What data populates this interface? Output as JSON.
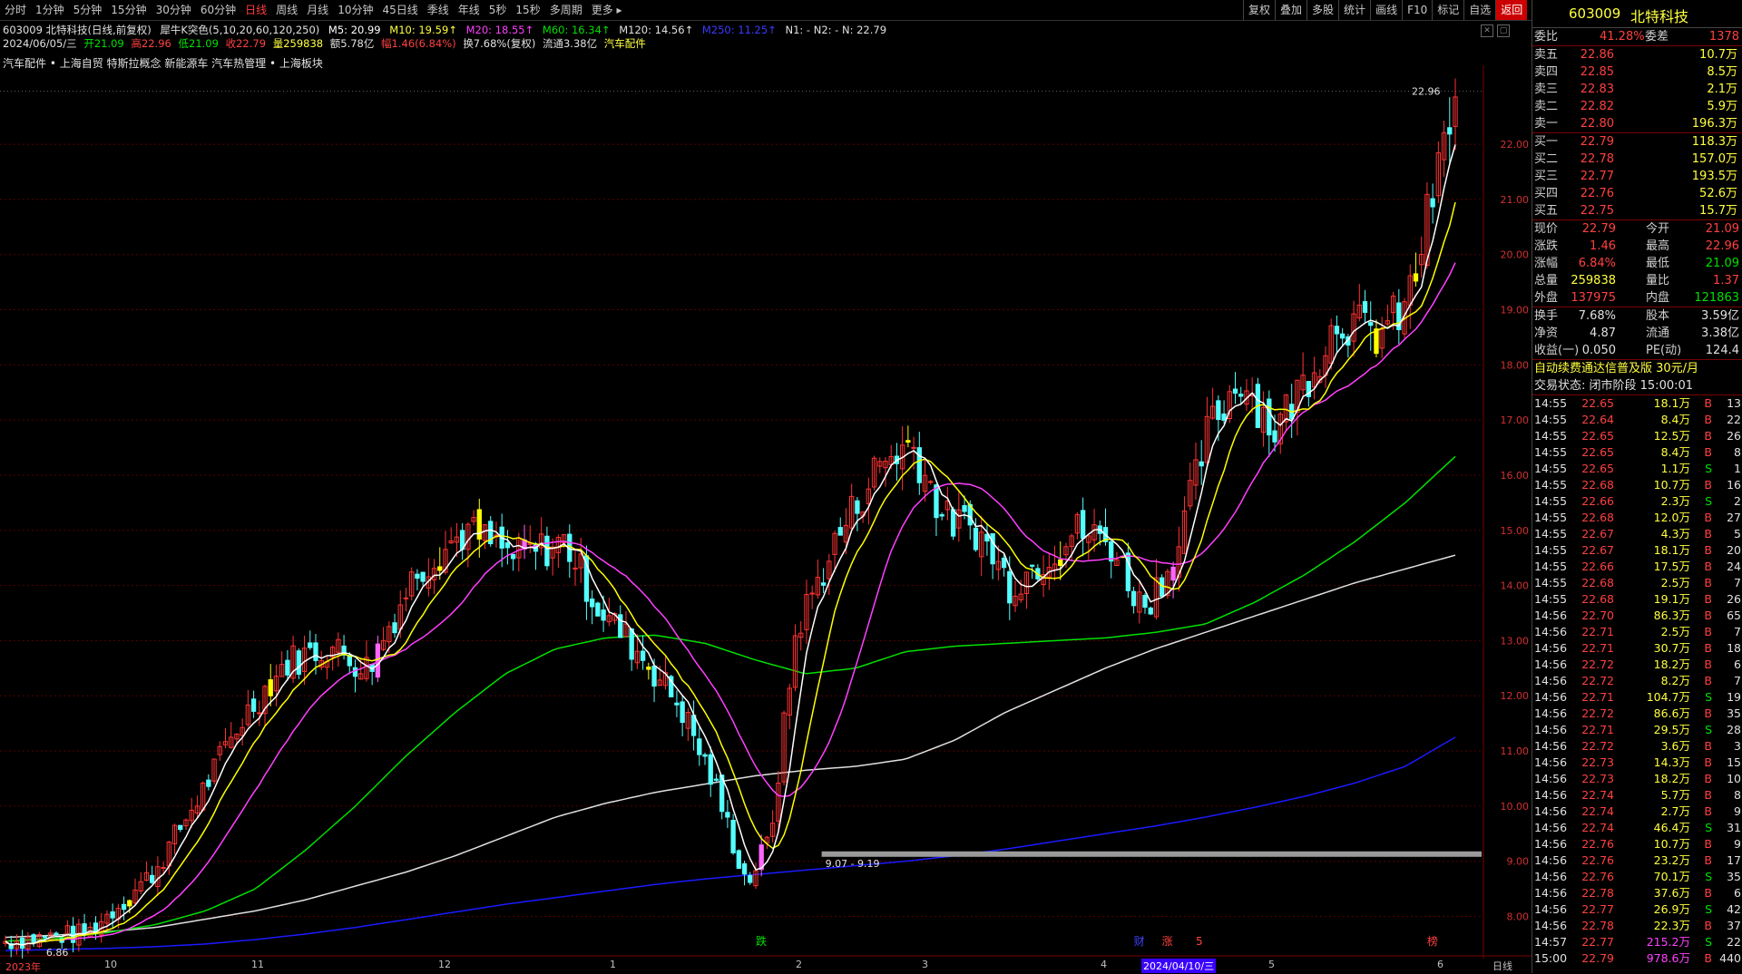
{
  "toolbar": {
    "periods": [
      "分时",
      "1分钟",
      "5分钟",
      "15分钟",
      "30分钟",
      "60分钟",
      "日线",
      "周线",
      "月线",
      "10分钟",
      "45日线",
      "季线",
      "年线",
      "5秒",
      "15秒",
      "多周期",
      "更多"
    ],
    "active_period": "日线",
    "right_buttons": [
      "复权",
      "叠加",
      "多股",
      "统计",
      "画线",
      "F10",
      "标记",
      "自选",
      "返回"
    ]
  },
  "info": {
    "stock": "603009 北特科技(日线,前复权)",
    "indicator": "犀牛K突色(5,10,20,60,120,250)",
    "m5": "M5: 20.99",
    "m10": "M10: 19.59↑",
    "m20": "M20: 18.55↑",
    "m60": "M60: 16.34↑",
    "m120": "M120: 14.56↑",
    "m250": "M250: 11.25↑",
    "n": "N1: -  N2: -  N: 22.79",
    "date": "2024/06/05/三",
    "open": "开21.09",
    "high": "高22.96",
    "low": "低21.09",
    "close": "收22.79",
    "vol": "量259838",
    "amt": "额5.78亿",
    "chg": "幅1.46(6.84%)",
    "turn": "换7.68%(复权)",
    "float": "流通3.38亿",
    "sector": "汽车配件",
    "concepts": "汽车配件 • 上海自贸 特斯拉概念 新能源车 汽车热管理 • 上海板块"
  },
  "chart_data": {
    "type": "candlestick",
    "y_ticks": [
      "22.00",
      "21.00",
      "20.00",
      "19.00",
      "18.00",
      "17.00",
      "16.00",
      "15.00",
      "14.00",
      "13.00",
      "12.00",
      "11.00",
      "10.00",
      "9.00",
      "8.00"
    ],
    "ylim": [
      7.4,
      23.3
    ],
    "max_label": "22.96",
    "min_label": "6.86",
    "gap_label": "9.07 - 9.19",
    "x_labels": [
      "2023年",
      "10",
      "11",
      "12",
      "1",
      "2",
      "3",
      "4",
      "2024/04/10/三",
      "5",
      "6",
      "日线"
    ],
    "markers": [
      "跌",
      "财",
      "涨",
      "5",
      "榜"
    ],
    "ma_colors": {
      "m5": "#ffffff",
      "m10": "#ffff00",
      "m20": "#ff40ff",
      "m60": "#00e000",
      "m120": "#e0e0e0",
      "m250": "#1a1aff"
    },
    "ma_levels": {
      "m120": [
        7.62,
        7.66,
        7.72,
        7.8,
        7.95,
        8.1,
        8.3,
        8.55,
        8.8,
        9.1,
        9.45,
        9.8,
        10.05,
        10.25,
        10.4,
        10.55,
        10.65,
        10.72,
        10.85,
        11.2,
        11.7,
        12.1,
        12.5,
        12.85,
        13.15,
        13.45,
        13.75,
        14.05,
        14.3,
        14.55
      ],
      "m250": [
        7.38,
        7.4,
        7.42,
        7.45,
        7.5,
        7.58,
        7.68,
        7.8,
        7.94,
        8.08,
        8.22,
        8.34,
        8.46,
        8.58,
        8.68,
        8.76,
        8.84,
        8.92,
        9.0,
        9.1,
        9.22,
        9.36,
        9.5,
        9.64,
        9.8,
        9.98,
        10.18,
        10.42,
        10.72,
        11.25
      ],
      "m60": [
        7.55,
        7.6,
        7.7,
        7.85,
        8.1,
        8.5,
        9.2,
        10.0,
        10.9,
        11.7,
        12.4,
        12.85,
        13.05,
        13.1,
        12.95,
        12.65,
        12.4,
        12.5,
        12.8,
        12.9,
        12.95,
        13.0,
        13.05,
        13.15,
        13.3,
        13.7,
        14.2,
        14.8,
        15.5,
        16.34
      ]
    }
  },
  "sidebar": {
    "code": "603009",
    "name": "北特科技",
    "weibi_label": "委比",
    "weibi": "41.28%",
    "weicha_label": "委差",
    "weicha": "1378",
    "sells": [
      {
        "label": "卖五",
        "price": "22.86",
        "vol": "10.7万"
      },
      {
        "label": "卖四",
        "price": "22.85",
        "vol": "8.5万"
      },
      {
        "label": "卖三",
        "price": "22.83",
        "vol": "2.1万"
      },
      {
        "label": "卖二",
        "price": "22.82",
        "vol": "5.9万"
      },
      {
        "label": "卖一",
        "price": "22.80",
        "vol": "196.3万"
      }
    ],
    "buys": [
      {
        "label": "买一",
        "price": "22.79",
        "vol": "118.3万"
      },
      {
        "label": "买二",
        "price": "22.78",
        "vol": "157.0万"
      },
      {
        "label": "买三",
        "price": "22.77",
        "vol": "193.5万"
      },
      {
        "label": "买四",
        "price": "22.76",
        "vol": "52.6万"
      },
      {
        "label": "买五",
        "price": "22.75",
        "vol": "15.7万"
      }
    ],
    "stats": [
      {
        "k1": "现价",
        "v1": "22.79",
        "k2": "今开",
        "v2": "21.09"
      },
      {
        "k1": "涨跌",
        "v1": "1.46",
        "k2": "最高",
        "v2": "22.96"
      },
      {
        "k1": "涨幅",
        "v1": "6.84%",
        "k2": "最低",
        "v2": "21.09"
      },
      {
        "k1": "总量",
        "v1": "259838",
        "k2": "量比",
        "v2": "1.37"
      },
      {
        "k1": "外盘",
        "v1": "137975",
        "k2": "内盘",
        "v2": "121863"
      }
    ],
    "stats2": [
      {
        "k1": "换手",
        "v1": "7.68%",
        "k2": "股本",
        "v2": "3.59亿"
      },
      {
        "k1": "净资",
        "v1": "4.87",
        "k2": "流通",
        "v2": "3.38亿"
      },
      {
        "k1": "收益(一)",
        "v1": "0.050",
        "k2": "PE(动)",
        "v2": "124.4"
      }
    ],
    "promo": "自动续费通达信普及版  30元/月",
    "trade_status": "交易状态: 闭市阶段  15:00:01",
    "ticks": [
      [
        "14:55",
        "22.65",
        "18.1万",
        "B",
        "13"
      ],
      [
        "14:55",
        "22.64",
        "8.4万",
        "B",
        "22"
      ],
      [
        "14:55",
        "22.65",
        "12.5万",
        "B",
        "26"
      ],
      [
        "14:55",
        "22.65",
        "8.4万",
        "B",
        "8"
      ],
      [
        "14:55",
        "22.65",
        "1.1万",
        "S",
        "1"
      ],
      [
        "14:55",
        "22.68",
        "10.7万",
        "B",
        "16"
      ],
      [
        "14:55",
        "22.66",
        "2.3万",
        "S",
        "2"
      ],
      [
        "14:55",
        "22.68",
        "12.0万",
        "B",
        "27"
      ],
      [
        "14:55",
        "22.67",
        "4.3万",
        "B",
        "5"
      ],
      [
        "14:55",
        "22.67",
        "18.1万",
        "B",
        "20"
      ],
      [
        "14:55",
        "22.66",
        "17.5万",
        "B",
        "24"
      ],
      [
        "14:55",
        "22.68",
        "2.5万",
        "B",
        "7"
      ],
      [
        "14:55",
        "22.68",
        "19.1万",
        "B",
        "26"
      ],
      [
        "14:56",
        "22.70",
        "86.3万",
        "B",
        "65"
      ],
      [
        "14:56",
        "22.71",
        "2.5万",
        "B",
        "7"
      ],
      [
        "14:56",
        "22.71",
        "30.7万",
        "B",
        "18"
      ],
      [
        "14:56",
        "22.72",
        "18.2万",
        "B",
        "6"
      ],
      [
        "14:56",
        "22.72",
        "8.2万",
        "B",
        "7"
      ],
      [
        "14:56",
        "22.71",
        "104.7万",
        "S",
        "19"
      ],
      [
        "14:56",
        "22.72",
        "86.6万",
        "B",
        "35"
      ],
      [
        "14:56",
        "22.71",
        "29.5万",
        "S",
        "28"
      ],
      [
        "14:56",
        "22.72",
        "3.6万",
        "B",
        "3"
      ],
      [
        "14:56",
        "22.73",
        "14.3万",
        "B",
        "15"
      ],
      [
        "14:56",
        "22.73",
        "18.2万",
        "B",
        "10"
      ],
      [
        "14:56",
        "22.74",
        "5.7万",
        "B",
        "8"
      ],
      [
        "14:56",
        "22.74",
        "2.7万",
        "B",
        "9"
      ],
      [
        "14:56",
        "22.74",
        "46.4万",
        "S",
        "31"
      ],
      [
        "14:56",
        "22.76",
        "10.7万",
        "B",
        "9"
      ],
      [
        "14:56",
        "22.76",
        "23.2万",
        "B",
        "17"
      ],
      [
        "14:56",
        "22.76",
        "70.1万",
        "S",
        "35"
      ],
      [
        "14:56",
        "22.78",
        "37.6万",
        "B",
        "6"
      ],
      [
        "14:56",
        "22.77",
        "26.9万",
        "S",
        "42"
      ],
      [
        "14:56",
        "22.78",
        "22.3万",
        "B",
        "37"
      ],
      [
        "14:57",
        "22.77",
        "215.2万",
        "S",
        "22"
      ],
      [
        "15:00",
        "22.79",
        "978.6万",
        "B",
        "440"
      ]
    ]
  }
}
